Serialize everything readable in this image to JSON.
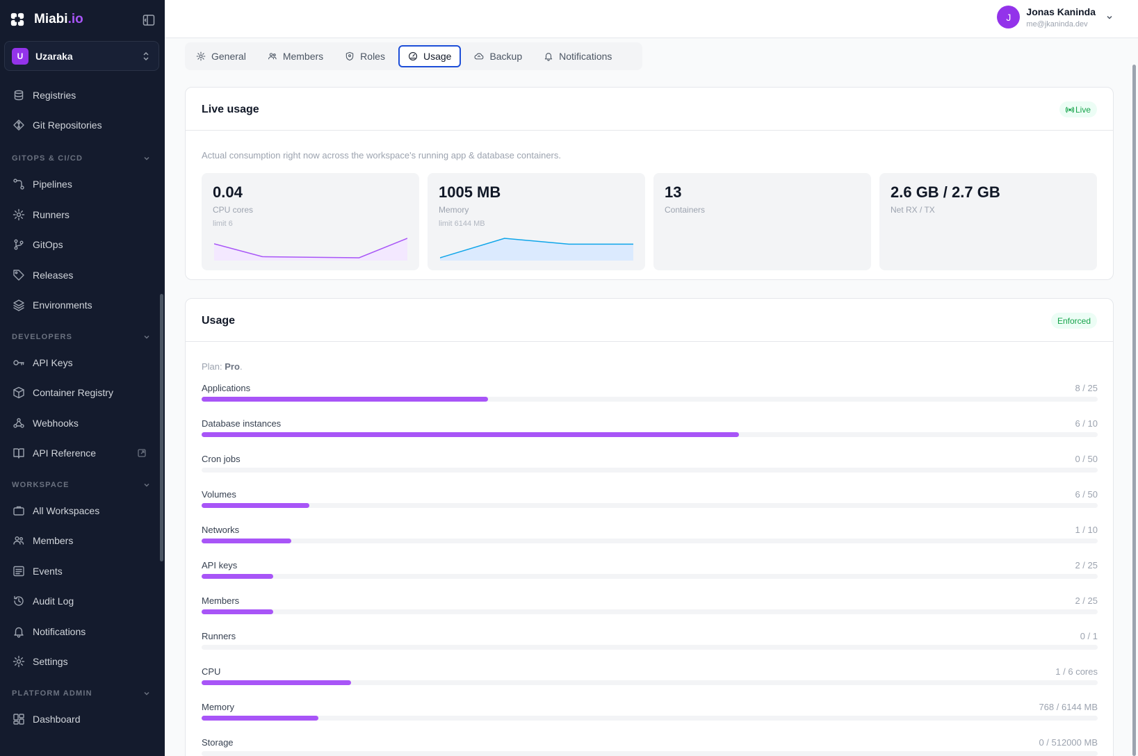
{
  "brand": {
    "name": "Miabi",
    "suffix": ".io"
  },
  "workspace": {
    "initial": "U",
    "name": "Uzaraka"
  },
  "sidebar": {
    "top_items": [
      {
        "label": "Registries",
        "icon": "database-icon"
      },
      {
        "label": "Git Repositories",
        "icon": "git-icon"
      }
    ],
    "sections": [
      {
        "title": "GITOPS & CI/CD",
        "items": [
          {
            "label": "Pipelines",
            "icon": "pipeline-icon"
          },
          {
            "label": "Runners",
            "icon": "gear-icon"
          },
          {
            "label": "GitOps",
            "icon": "git-branch-icon"
          },
          {
            "label": "Releases",
            "icon": "tag-icon"
          },
          {
            "label": "Environments",
            "icon": "layers-icon"
          }
        ]
      },
      {
        "title": "DEVELOPERS",
        "items": [
          {
            "label": "API Keys",
            "icon": "key-icon"
          },
          {
            "label": "Container Registry",
            "icon": "box-icon"
          },
          {
            "label": "Webhooks",
            "icon": "webhook-icon"
          },
          {
            "label": "API Reference",
            "icon": "book-icon",
            "external": true
          }
        ]
      },
      {
        "title": "WORKSPACE",
        "items": [
          {
            "label": "All Workspaces",
            "icon": "briefcase-icon"
          },
          {
            "label": "Members",
            "icon": "users-icon"
          },
          {
            "label": "Events",
            "icon": "list-icon"
          },
          {
            "label": "Audit Log",
            "icon": "history-icon"
          },
          {
            "label": "Notifications",
            "icon": "bell-icon"
          },
          {
            "label": "Settings",
            "icon": "gear-icon"
          }
        ]
      },
      {
        "title": "PLATFORM ADMIN",
        "items": [
          {
            "label": "Dashboard",
            "icon": "dashboard-icon"
          }
        ]
      }
    ]
  },
  "user": {
    "initial": "J",
    "name": "Jonas Kaninda",
    "email": "me@jkaninda.dev"
  },
  "tabs": [
    {
      "label": "General",
      "icon": "gear-icon",
      "active": false
    },
    {
      "label": "Members",
      "icon": "users-icon",
      "active": false
    },
    {
      "label": "Roles",
      "icon": "shield-icon",
      "active": false
    },
    {
      "label": "Usage",
      "icon": "gauge-icon",
      "active": true
    },
    {
      "label": "Backup",
      "icon": "cloud-icon",
      "active": false
    },
    {
      "label": "Notifications",
      "icon": "bell-icon",
      "active": false
    }
  ],
  "live": {
    "title": "Live usage",
    "badge": "Live",
    "description": "Actual consumption right now across the workspace's running app & database containers.",
    "stats": [
      {
        "value": "0.04",
        "label": "CPU cores",
        "sub": "limit 6",
        "spark": [
          0.03,
          0.006,
          0.005,
          0.004,
          0.04
        ],
        "spark_color": "#a855f7",
        "spark_fill": "#f3e8ff"
      },
      {
        "value": "1005 MB",
        "label": "Memory",
        "sub": "limit 6144 MB",
        "spark": [
          1000,
          1010,
          1007,
          1007
        ],
        "spark_color": "#0ea5e9",
        "spark_fill": "#dbeafe"
      },
      {
        "value": "13",
        "label": "Containers",
        "sub": ""
      },
      {
        "value": "2.6 GB / 2.7 GB",
        "label": "Net RX / TX",
        "sub": ""
      }
    ]
  },
  "usage": {
    "title": "Usage",
    "badge": "Enforced",
    "plan_label": "Plan:",
    "plan_name": "Pro",
    "rows": [
      {
        "label": "Applications",
        "value": "8 / 25",
        "fraction": 0.32
      },
      {
        "label": "Database instances",
        "value": "6 / 10",
        "fraction": 0.6
      },
      {
        "label": "Cron jobs",
        "value": "0 / 50",
        "fraction": 0
      },
      {
        "label": "Volumes",
        "value": "6 / 50",
        "fraction": 0.12
      },
      {
        "label": "Networks",
        "value": "1 / 10",
        "fraction": 0.1
      },
      {
        "label": "API keys",
        "value": "2 / 25",
        "fraction": 0.08
      },
      {
        "label": "Members",
        "value": "2 / 25",
        "fraction": 0.08
      },
      {
        "label": "Runners",
        "value": "0 / 1",
        "fraction": 0
      },
      {
        "label": "CPU",
        "value": "1 / 6 cores",
        "fraction": 0.1667
      },
      {
        "label": "Memory",
        "value": "768 / 6144 MB",
        "fraction": 0.13
      },
      {
        "label": "Storage",
        "value": "0 / 512000 MB",
        "fraction": 0
      }
    ]
  }
}
